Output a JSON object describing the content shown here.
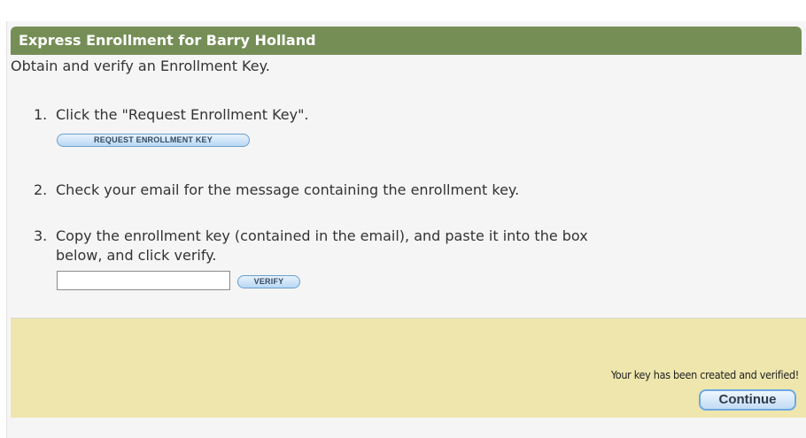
{
  "header": {
    "title": "Express Enrollment for Barry Holland"
  },
  "intro": "Obtain and verify an Enrollment Key.",
  "steps": [
    {
      "number": "1.",
      "text": "Click the \"Request Enrollment Key\".",
      "button": "REQUEST ENROLLMENT KEY"
    },
    {
      "number": "2.",
      "text": "Check your email for the message containing the enrollment key."
    },
    {
      "number": "3.",
      "text_line1": "Copy the enrollment key (contained in the email), and paste it into the box",
      "text_line2": "below, and click verify.",
      "button": "VERIFY",
      "input_value": ""
    }
  ],
  "footer": {
    "status": "Your key has been created and verified!",
    "continue_label": "Continue"
  },
  "colors": {
    "title_bar": "#758e56",
    "footer_background": "#eee6ad",
    "button_border": "#6a9fd0"
  }
}
